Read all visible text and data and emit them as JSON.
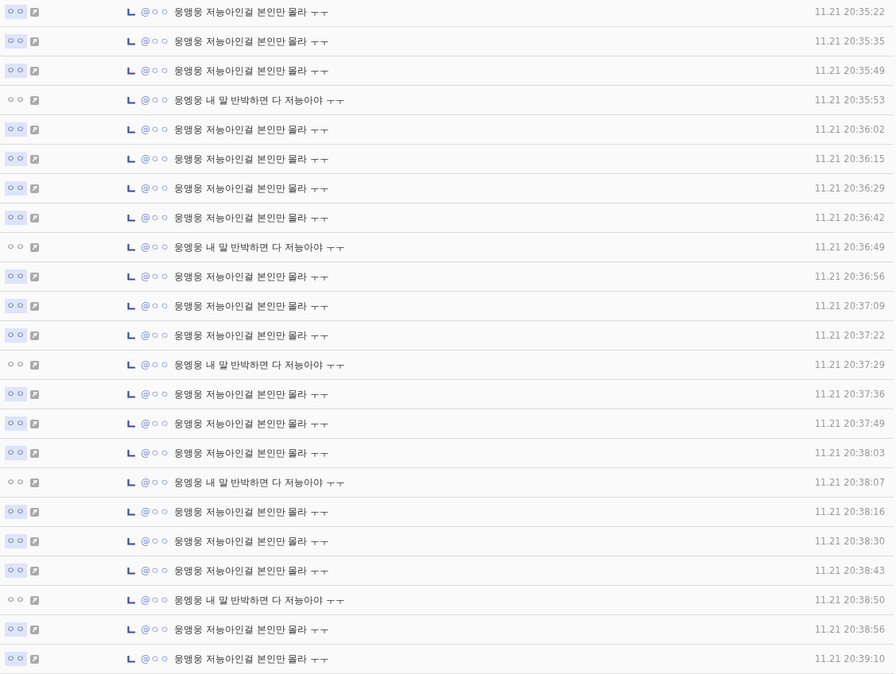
{
  "comments": [
    {
      "author": "ㅇㅇ",
      "highlighted": true,
      "mention": "@ㅇㅇ",
      "text": "웅앵웅 저능아인걸 본인만 몰라 ㅜㅜ",
      "time": "11.21 20:35:22"
    },
    {
      "author": "ㅇㅇ",
      "highlighted": true,
      "mention": "@ㅇㅇ",
      "text": "웅앵웅 저능아인걸 본인만 몰라 ㅜㅜ",
      "time": "11.21 20:35:35"
    },
    {
      "author": "ㅇㅇ",
      "highlighted": true,
      "mention": "@ㅇㅇ",
      "text": "웅앵웅 저능아인걸 본인만 몰라 ㅜㅜ",
      "time": "11.21 20:35:49"
    },
    {
      "author": "ㅇㅇ",
      "highlighted": false,
      "mention": "@ㅇㅇ",
      "text": "웅엥웅 내 말 반박하면 다 저능아야 ㅜㅜ",
      "time": "11.21 20:35:53"
    },
    {
      "author": "ㅇㅇ",
      "highlighted": true,
      "mention": "@ㅇㅇ",
      "text": "웅앵웅 저능아인걸 본인만 몰라 ㅜㅜ",
      "time": "11.21 20:36:02"
    },
    {
      "author": "ㅇㅇ",
      "highlighted": true,
      "mention": "@ㅇㅇ",
      "text": "웅앵웅 저능아인걸 본인만 몰라 ㅜㅜ",
      "time": "11.21 20:36:15"
    },
    {
      "author": "ㅇㅇ",
      "highlighted": true,
      "mention": "@ㅇㅇ",
      "text": "웅앵웅 저능아인걸 본인만 몰라 ㅜㅜ",
      "time": "11.21 20:36:29"
    },
    {
      "author": "ㅇㅇ",
      "highlighted": true,
      "mention": "@ㅇㅇ",
      "text": "웅앵웅 저능아인걸 본인만 몰라 ㅜㅜ",
      "time": "11.21 20:36:42"
    },
    {
      "author": "ㅇㅇ",
      "highlighted": false,
      "mention": "@ㅇㅇ",
      "text": "웅엥웅 내 말 반박하면 다 저능아야 ㅜㅜ",
      "time": "11.21 20:36:49"
    },
    {
      "author": "ㅇㅇ",
      "highlighted": true,
      "mention": "@ㅇㅇ",
      "text": "웅앵웅 저능아인걸 본인만 몰라 ㅜㅜ",
      "time": "11.21 20:36:56"
    },
    {
      "author": "ㅇㅇ",
      "highlighted": true,
      "mention": "@ㅇㅇ",
      "text": "웅앵웅 저능아인걸 본인만 몰라 ㅜㅜ",
      "time": "11.21 20:37:09"
    },
    {
      "author": "ㅇㅇ",
      "highlighted": true,
      "mention": "@ㅇㅇ",
      "text": "웅앵웅 저능아인걸 본인만 몰라 ㅜㅜ",
      "time": "11.21 20:37:22"
    },
    {
      "author": "ㅇㅇ",
      "highlighted": false,
      "mention": "@ㅇㅇ",
      "text": "웅엥웅 내 말 반박하면 다 저능아야 ㅜㅜ",
      "time": "11.21 20:37:29"
    },
    {
      "author": "ㅇㅇ",
      "highlighted": true,
      "mention": "@ㅇㅇ",
      "text": "웅앵웅 저능아인걸 본인만 몰라 ㅜㅜ",
      "time": "11.21 20:37:36"
    },
    {
      "author": "ㅇㅇ",
      "highlighted": true,
      "mention": "@ㅇㅇ",
      "text": "웅앵웅 저능아인걸 본인만 몰라 ㅜㅜ",
      "time": "11.21 20:37:49"
    },
    {
      "author": "ㅇㅇ",
      "highlighted": true,
      "mention": "@ㅇㅇ",
      "text": "웅앵웅 저능아인걸 본인만 몰라 ㅜㅜ",
      "time": "11.21 20:38:03"
    },
    {
      "author": "ㅇㅇ",
      "highlighted": false,
      "mention": "@ㅇㅇ",
      "text": "웅엥웅 내 말 반박하면 다 저능아야 ㅜㅜ",
      "time": "11.21 20:38:07"
    },
    {
      "author": "ㅇㅇ",
      "highlighted": true,
      "mention": "@ㅇㅇ",
      "text": "웅앵웅 저능아인걸 본인만 몰라 ㅜㅜ",
      "time": "11.21 20:38:16"
    },
    {
      "author": "ㅇㅇ",
      "highlighted": true,
      "mention": "@ㅇㅇ",
      "text": "웅앵웅 저능아인걸 본인만 몰라 ㅜㅜ",
      "time": "11.21 20:38:30"
    },
    {
      "author": "ㅇㅇ",
      "highlighted": true,
      "mention": "@ㅇㅇ",
      "text": "웅앵웅 저능아인걸 본인만 몰라 ㅜㅜ",
      "time": "11.21 20:38:43"
    },
    {
      "author": "ㅇㅇ",
      "highlighted": false,
      "mention": "@ㅇㅇ",
      "text": "웅엥웅 내 말 반박하면 다 저능아야 ㅜㅜ",
      "time": "11.21 20:38:50"
    },
    {
      "author": "ㅇㅇ",
      "highlighted": true,
      "mention": "@ㅇㅇ",
      "text": "웅앵웅 저능아인걸 본인만 몰라 ㅜㅜ",
      "time": "11.21 20:38:56"
    },
    {
      "author": "ㅇㅇ",
      "highlighted": true,
      "mention": "@ㅇㅇ",
      "text": "웅앵웅 저능아인걸 본인만 몰라 ㅜㅜ",
      "time": "11.21 20:39:10"
    }
  ]
}
